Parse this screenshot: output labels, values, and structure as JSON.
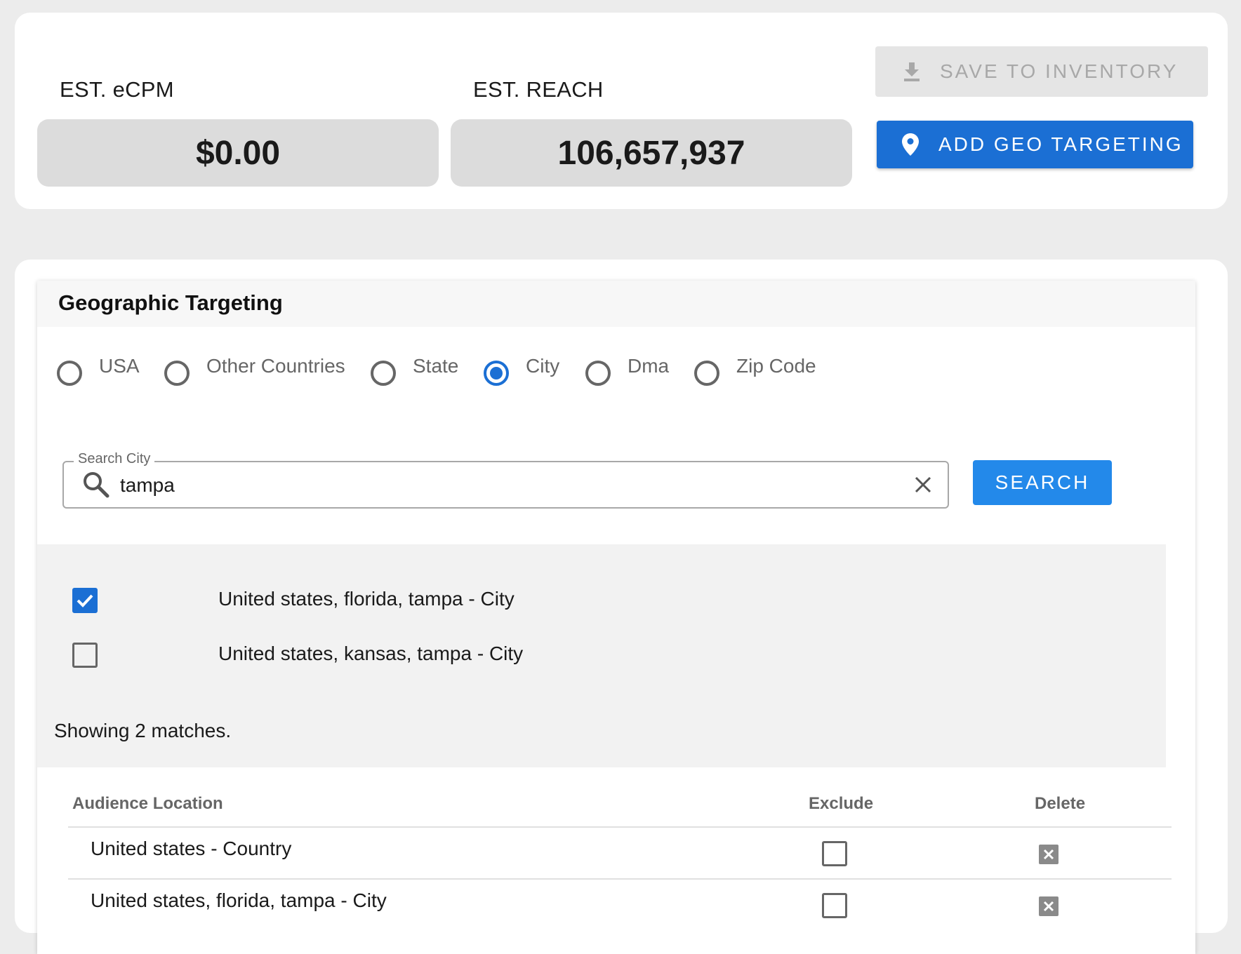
{
  "stats": {
    "ecpm_label": "EST. eCPM",
    "ecpm_value": "$0.00",
    "reach_label": "EST. REACH",
    "reach_value": "106,657,937"
  },
  "actions": {
    "save_label": "SAVE TO INVENTORY",
    "save_icon": "download-icon",
    "geo_label": "ADD GEO TARGETING",
    "geo_icon": "location-pin-icon"
  },
  "geo": {
    "title": "Geographic Targeting",
    "radio_options": [
      {
        "label": "USA",
        "selected": false
      },
      {
        "label": "Other Countries",
        "selected": false
      },
      {
        "label": "State",
        "selected": false
      },
      {
        "label": "City",
        "selected": true
      },
      {
        "label": "Dma",
        "selected": false
      },
      {
        "label": "Zip Code",
        "selected": false
      }
    ],
    "search": {
      "legend": "Search City",
      "value": "tampa",
      "button_label": "SEARCH"
    },
    "results": [
      {
        "label": "United states, florida, tampa - City",
        "checked": true
      },
      {
        "label": "United states, kansas, tampa - City",
        "checked": false
      }
    ],
    "matches_text": "Showing 2 matches.",
    "table": {
      "headers": {
        "location": "Audience Location",
        "exclude": "Exclude",
        "delete": "Delete"
      },
      "rows": [
        {
          "location": "United states - Country",
          "exclude": false
        },
        {
          "location": "United states, florida, tampa - City",
          "exclude": false
        }
      ]
    }
  },
  "colors": {
    "primary": "#1b6fd4",
    "search_button": "#2389ea",
    "stat_box": "#dcdcdc",
    "page_bg": "#ececec"
  }
}
